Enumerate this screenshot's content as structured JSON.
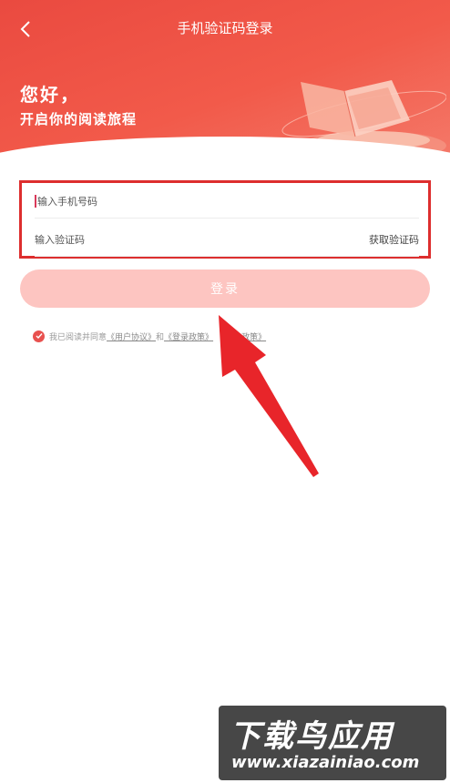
{
  "header": {
    "title": "手机验证码登录",
    "greeting_line1": "您好，",
    "greeting_line2": "开启你的阅读旅程"
  },
  "form": {
    "phone_placeholder": "输入手机号码",
    "code_placeholder": "输入验证码",
    "get_code_label": "获取验证码"
  },
  "login_button": "登录",
  "agreement": {
    "prefix": "我已阅读并同意",
    "user_agreement": "《用户协议》",
    "and": "和",
    "login_policy": "《登录政策》",
    "privacy_policy": "私政策》"
  },
  "watermark": {
    "brand": "下载鸟应用",
    "url": "www.xiazainiao.com"
  },
  "colors": {
    "header_red": "#ea4a40",
    "highlight_border": "#dd2e2e",
    "login_button_bg": "#fdc5c1",
    "check_red": "#e8514f"
  }
}
